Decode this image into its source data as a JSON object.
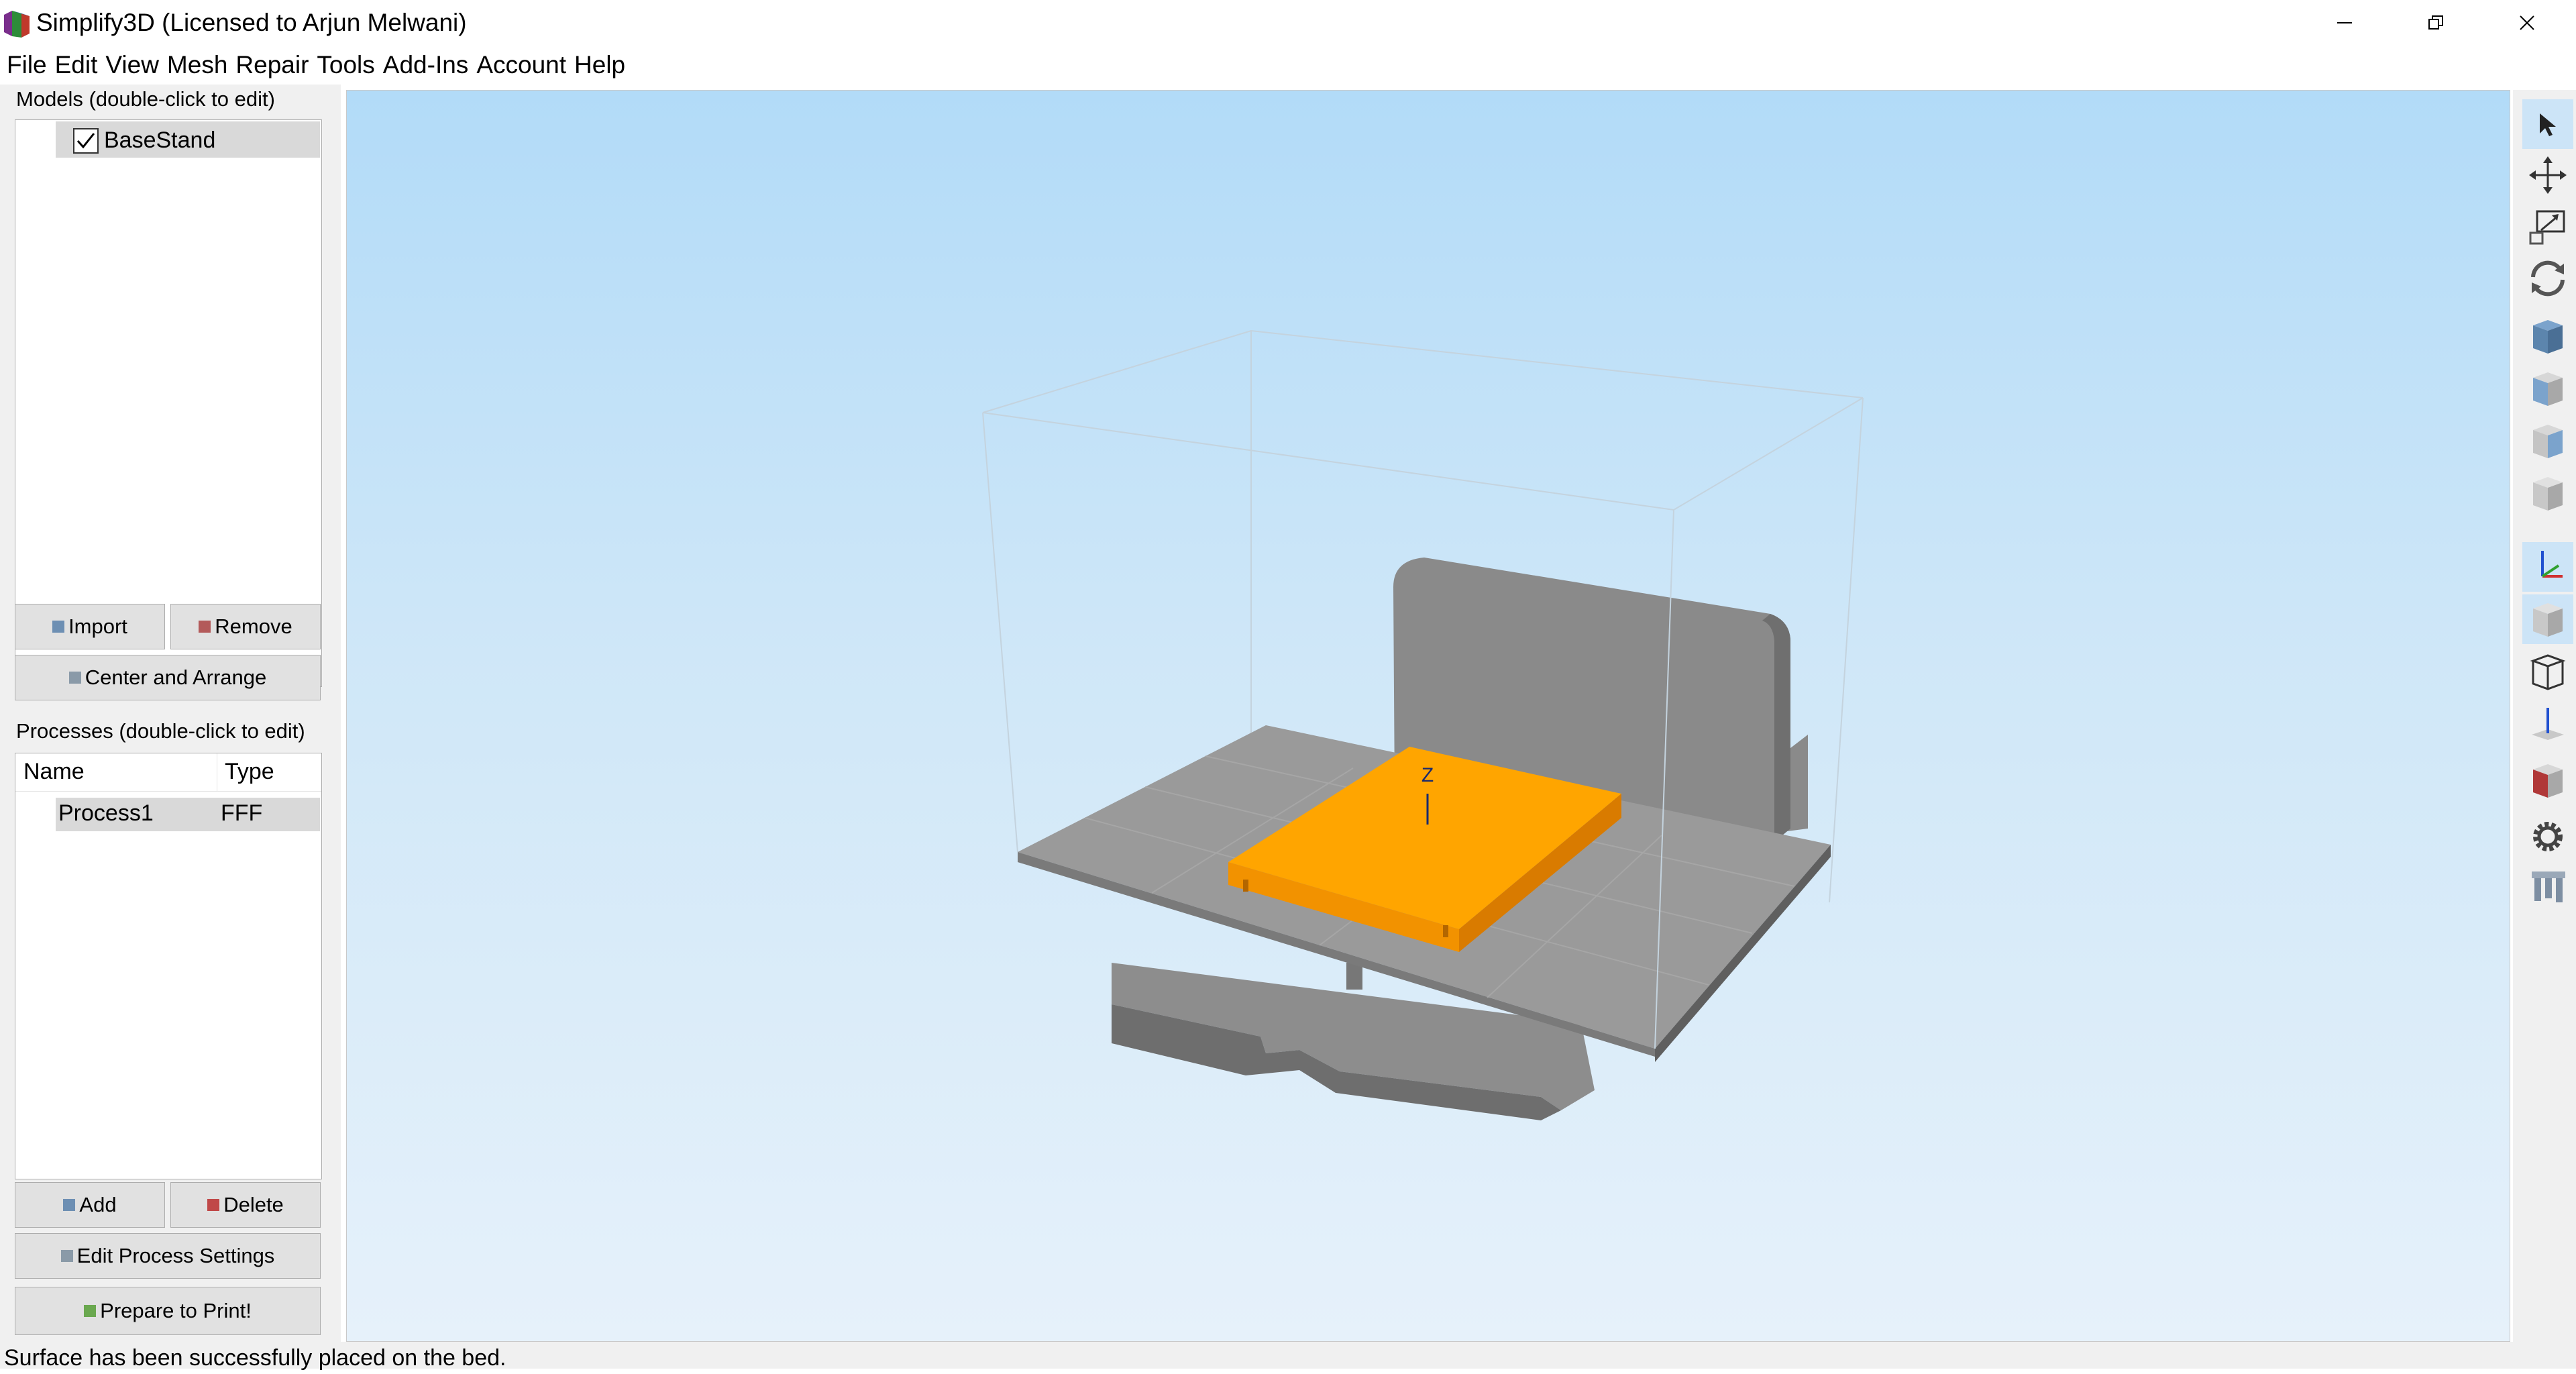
{
  "window": {
    "title": "Simplify3D (Licensed to Arjun Melwani)"
  },
  "menu": [
    "File",
    "Edit",
    "View",
    "Mesh",
    "Repair",
    "Tools",
    "Add-Ins",
    "Account",
    "Help"
  ],
  "models": {
    "label": "Models (double-click to edit)",
    "items": [
      {
        "name": "BaseStand",
        "checked": true
      }
    ],
    "import_label": "Import",
    "remove_label": "Remove",
    "center_arrange_label": "Center and Arrange"
  },
  "processes": {
    "label": "Processes (double-click to edit)",
    "columns": [
      "Name",
      "Type"
    ],
    "rows": [
      {
        "name": "Process1",
        "type": "FFF"
      }
    ],
    "add_label": "Add",
    "delete_label": "Delete",
    "edit_settings_label": "Edit Process Settings",
    "prepare_label": "Prepare to Print!"
  },
  "viewport": {
    "axis_label": "Z",
    "model_color": "#ffa500",
    "bed_color": "#8c8c8c"
  },
  "toolbar_icons": [
    "select-icon",
    "move-icon",
    "scale-icon",
    "rotate-icon",
    "view-top-icon",
    "view-front-icon",
    "view-side-icon",
    "view-iso-icon",
    "axes-icon",
    "solid-view-icon",
    "wireframe-icon",
    "z-axis-icon",
    "section-view-icon",
    "settings-gear-icon",
    "supports-icon"
  ],
  "status": {
    "message": "Surface has been successfully placed on the bed."
  }
}
